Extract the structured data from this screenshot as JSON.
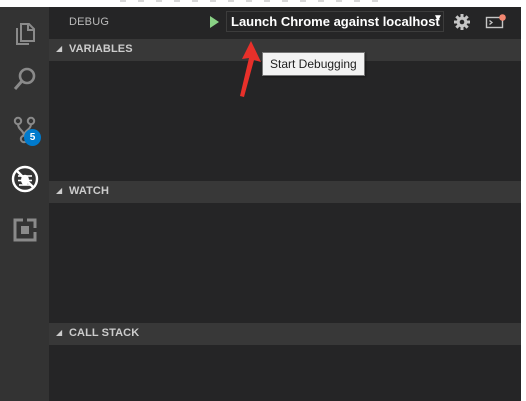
{
  "debug_view": {
    "title": "DEBUG",
    "configuration": "Launch Chrome against localhost",
    "start_icon": "play-icon",
    "settings_icon": "gear-icon",
    "console_icon": "debug-console-icon"
  },
  "tooltip": {
    "text": "Start Debugging"
  },
  "sections": {
    "variables": "VARIABLES",
    "watch": "WATCH",
    "call_stack": "CALL STACK"
  },
  "activity_bar": {
    "items": [
      {
        "icon": "explorer-icon"
      },
      {
        "icon": "search-icon"
      },
      {
        "icon": "source-control-icon",
        "badge": "5"
      },
      {
        "icon": "debug-icon"
      },
      {
        "icon": "extensions-icon"
      }
    ]
  },
  "colors": {
    "activity_bar": "#333333",
    "sidebar": "#252526",
    "section_header": "#383838",
    "play_green": "#89d185",
    "badge_blue": "#007acc",
    "annotation_red": "#e8302a"
  }
}
